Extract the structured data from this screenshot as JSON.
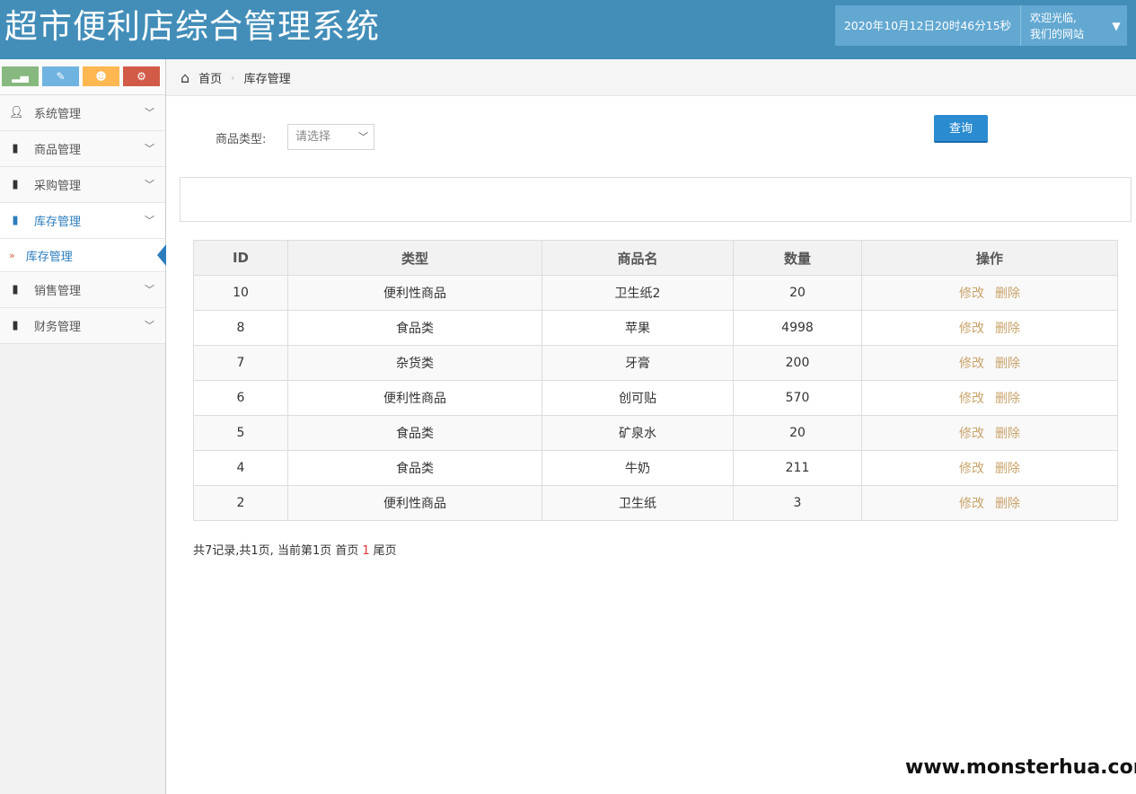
{
  "app": {
    "title": "超市便利店综合管理系统"
  },
  "header": {
    "datetime": "2020年10月12日20时46分15秒",
    "welcome_line1": "欢迎光临,",
    "welcome_line2": "我们的网站",
    "caret": "▼"
  },
  "shortcuts": [
    {
      "name": "signal-icon",
      "glyph": "▂▄",
      "color": "#87b87f"
    },
    {
      "name": "pencil-icon",
      "glyph": "✎",
      "color": "#6fb3e0"
    },
    {
      "name": "group-icon",
      "glyph": "☻",
      "color": "#ffb752"
    },
    {
      "name": "cogs-icon",
      "glyph": "⚙",
      "color": "#d15b47"
    }
  ],
  "sidebar": {
    "items": [
      {
        "label": "系统管理"
      },
      {
        "label": "商品管理"
      },
      {
        "label": "采购管理"
      },
      {
        "label": "库存管理"
      },
      {
        "label": "库存管理"
      },
      {
        "label": "销售管理"
      },
      {
        "label": "财务管理"
      }
    ]
  },
  "breadcrumb": {
    "home": "首页",
    "current": "库存管理"
  },
  "search": {
    "label": "商品类型:",
    "placeholder": "请选择",
    "button": "查询"
  },
  "table": {
    "headers": [
      "ID",
      "类型",
      "商品名",
      "数量",
      "操作"
    ],
    "rows": [
      [
        "10",
        "便利性商品",
        "卫生纸2",
        "20"
      ],
      [
        "8",
        "食品类",
        "苹果",
        "4998"
      ],
      [
        "7",
        "杂货类",
        "牙膏",
        "200"
      ],
      [
        "6",
        "便利性商品",
        "创可贴",
        "570"
      ],
      [
        "5",
        "食品类",
        "矿泉水",
        "20"
      ],
      [
        "4",
        "食品类",
        "牛奶",
        "211"
      ],
      [
        "2",
        "便利性商品",
        "卫生纸",
        "3"
      ]
    ],
    "edit_label": "修改",
    "delete_label": "删除"
  },
  "pager": {
    "summary": "共7记录,共1页, 当前第1页 首页",
    "current": "1",
    "last": "尾页"
  },
  "watermark": "www.monsterhua.com"
}
